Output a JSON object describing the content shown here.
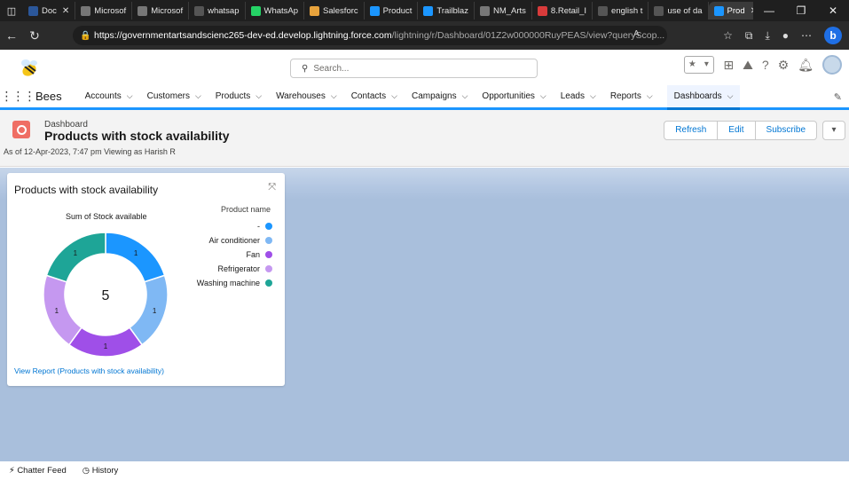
{
  "browser": {
    "tabs": [
      {
        "label": "Doc",
        "color": "#2b579a",
        "active": false,
        "closable": true
      },
      {
        "label": "Microsof",
        "color": "#777777",
        "active": false
      },
      {
        "label": "Microsof",
        "color": "#777777",
        "active": false
      },
      {
        "label": "whatsap",
        "color": "#555555",
        "active": false
      },
      {
        "label": "WhatsAp",
        "color": "#25d366",
        "active": false
      },
      {
        "label": "Salesforc",
        "color": "#e8a33c",
        "active": false
      },
      {
        "label": "Product",
        "color": "#1b96ff",
        "active": false
      },
      {
        "label": "Trailblaz",
        "color": "#1b96ff",
        "active": false
      },
      {
        "label": "NM_Arts",
        "color": "#777777",
        "active": false
      },
      {
        "label": "8.Retail_I",
        "color": "#d83b3b",
        "active": false
      },
      {
        "label": "english t",
        "color": "#555555",
        "active": false
      },
      {
        "label": "use of da",
        "color": "#555555",
        "active": false
      },
      {
        "label": "Prod",
        "color": "#1b96ff",
        "active": true,
        "closable": true
      }
    ],
    "url_host": "https://governmentartsandscienc265-dev-ed.develop.lightning.force.com",
    "url_path": "/lightning/r/Dashboard/01Z2w000000RuyPEAS/view?queryScop...",
    "reader_badge": "A"
  },
  "header": {
    "search_placeholder": "Search..."
  },
  "nav": {
    "app_name": "Bees",
    "items": [
      {
        "label": "Accounts",
        "active": false
      },
      {
        "label": "Customers",
        "active": false
      },
      {
        "label": "Products",
        "active": false
      },
      {
        "label": "Warehouses",
        "active": false
      },
      {
        "label": "Contacts",
        "active": false
      },
      {
        "label": "Campaigns",
        "active": false
      },
      {
        "label": "Opportunities",
        "active": false
      },
      {
        "label": "Leads",
        "active": false
      },
      {
        "label": "Reports",
        "active": false
      },
      {
        "label": "Dashboards",
        "active": true
      }
    ]
  },
  "dashboard": {
    "kind": "Dashboard",
    "title": "Products with stock availability",
    "as_of": "As of 12-Apr-2023, 7:47 pm Viewing as Harish R",
    "buttons": {
      "refresh": "Refresh",
      "edit": "Edit",
      "subscribe": "Subscribe"
    }
  },
  "widget": {
    "title": "Products with stock availability",
    "subtitle": "Sum of Stock available",
    "legend_title": "Product name",
    "total": "5",
    "link": "View Report (Products with stock availability)"
  },
  "chart_data": {
    "type": "pie",
    "title": "Sum of Stock available",
    "legend_title": "Product name",
    "total": 5,
    "slices": [
      {
        "label": "-",
        "value": 1,
        "color": "#1b96ff"
      },
      {
        "label": "Air conditioner",
        "value": 1,
        "color": "#7fb8f4"
      },
      {
        "label": "Fan",
        "value": 1,
        "color": "#9f4fe8"
      },
      {
        "label": "Refrigerator",
        "value": 1,
        "color": "#c598f0"
      },
      {
        "label": "Washing machine",
        "value": 1,
        "color": "#1ea597"
      }
    ]
  },
  "footer": {
    "chatter": "Chatter Feed",
    "history": "History"
  }
}
